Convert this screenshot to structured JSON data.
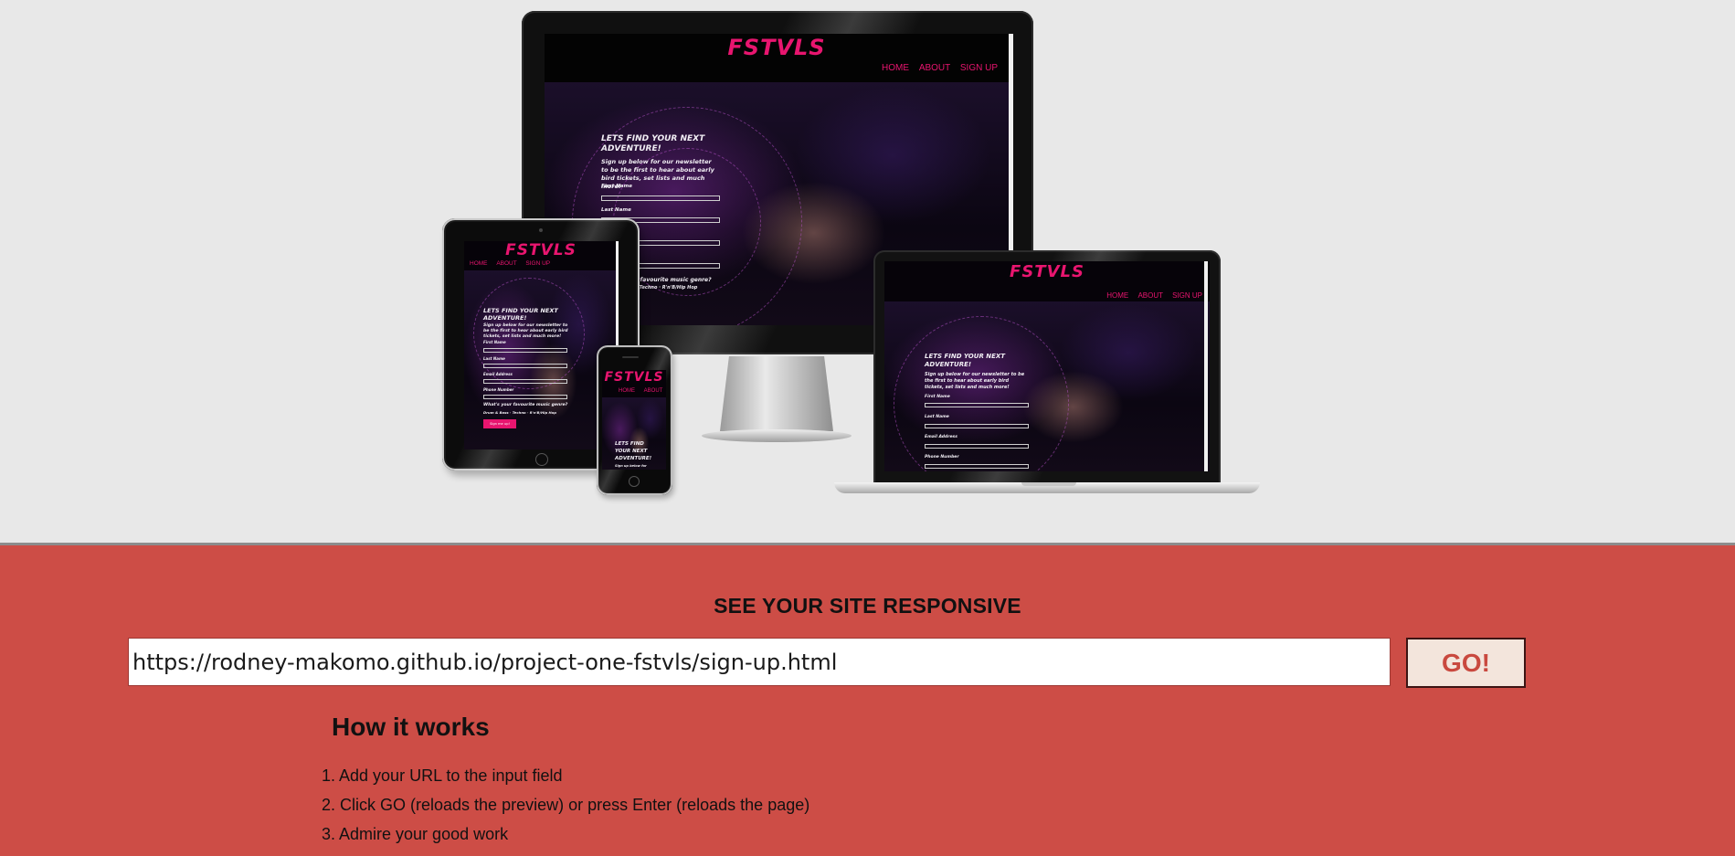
{
  "preview": {
    "site_logo": "FSTVLS",
    "nav": [
      "HOME",
      "ABOUT",
      "SIGN UP"
    ],
    "hero_heading": "LETS FIND YOUR NEXT ADVENTURE!",
    "hero_text": "Sign up below for our newsletter to be the first to hear about early bird tickets, set lists and much more!",
    "fields": [
      "First Name",
      "Last Name",
      "Email Address",
      "Phone Number"
    ],
    "genre_question": "What's your favourite music genre?",
    "genre_options": "Drum & Bass · Techno · R'n'B/Hip Hop",
    "submit_label": "Sign me up!",
    "tablet_submit_label": "Sign me up!",
    "phone_snippet": "Sign up below for"
  },
  "form": {
    "heading": "SEE YOUR SITE RESPONSIVE",
    "url_value": "https://rodney-makomo.github.io/project-one-fstvls/sign-up.html",
    "go_label": "GO!"
  },
  "how": {
    "title": "How it works",
    "steps": [
      "1. Add your URL to the input field",
      "2. Click GO (reloads the preview) or press Enter (reloads the page)",
      "3. Admire your good work"
    ]
  },
  "colors": {
    "accent_pink": "#e8156f",
    "section_red": "#cd4d46",
    "go_text": "#c9493f"
  }
}
